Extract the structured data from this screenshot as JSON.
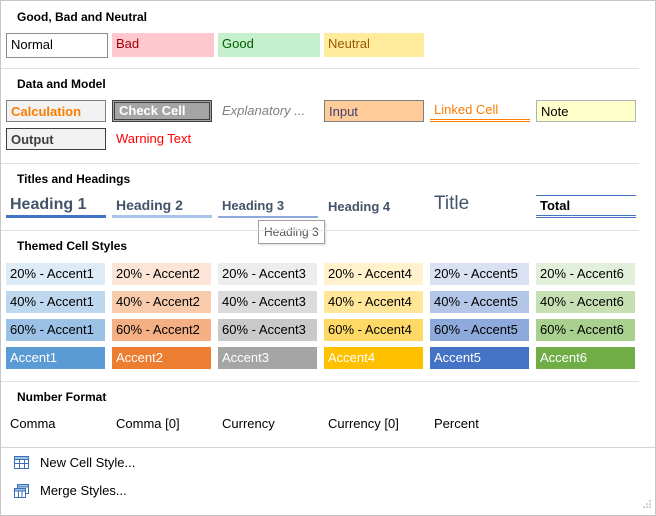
{
  "sections": {
    "good_bad": "Good, Bad and Neutral",
    "data_model": "Data and Model",
    "titles": "Titles and Headings",
    "themed": "Themed Cell Styles",
    "number": "Number Format"
  },
  "good_bad": [
    "Normal",
    "Bad",
    "Good",
    "Neutral"
  ],
  "data_model": [
    "Calculation",
    "Check Cell",
    "Explanatory ...",
    "Input",
    "Linked Cell",
    "Note",
    "Output",
    "Warning Text"
  ],
  "titles": [
    "Heading 1",
    "Heading 2",
    "Heading 3",
    "Heading 4",
    "Title",
    "Total"
  ],
  "tooltip": "Heading 3",
  "themed": [
    [
      "20% - Accent1",
      "20% - Accent2",
      "20% - Accent3",
      "20% - Accent4",
      "20% - Accent5",
      "20% - Accent6"
    ],
    [
      "40% - Accent1",
      "40% - Accent2",
      "40% - Accent3",
      "40% - Accent4",
      "40% - Accent5",
      "40% - Accent6"
    ],
    [
      "60% - Accent1",
      "60% - Accent2",
      "60% - Accent3",
      "60% - Accent4",
      "60% - Accent5",
      "60% - Accent6"
    ],
    [
      "Accent1",
      "Accent2",
      "Accent3",
      "Accent4",
      "Accent5",
      "Accent6"
    ]
  ],
  "number": [
    "Comma",
    "Comma [0]",
    "Currency",
    "Currency [0]",
    "Percent"
  ],
  "menu": {
    "new_style": "New Cell Style...",
    "merge_styles": "Merge Styles..."
  },
  "colors": {
    "accent1": "#5b9bd5",
    "accent2": "#ed7d31",
    "accent3": "#a5a5a5",
    "accent4": "#ffc000",
    "accent5": "#4472c4",
    "accent6": "#70ad47"
  }
}
